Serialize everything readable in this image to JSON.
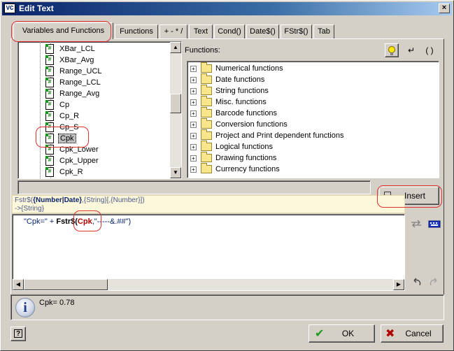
{
  "window": {
    "title": "Edit Text",
    "app_icon": "VC",
    "close": "×"
  },
  "tabs": [
    {
      "label": "Variables and Functions"
    },
    {
      "label": "Functions"
    },
    {
      "label": "+ - * /"
    },
    {
      "label": "Text"
    },
    {
      "label": "Cond()"
    },
    {
      "label": "Date$()"
    },
    {
      "label": "FStr$()"
    },
    {
      "label": "Tab"
    }
  ],
  "variables": [
    {
      "label": "XBar_LCL"
    },
    {
      "label": "XBar_Avg"
    },
    {
      "label": "Range_UCL"
    },
    {
      "label": "Range_LCL"
    },
    {
      "label": "Range_Avg"
    },
    {
      "label": "Cp"
    },
    {
      "label": "Cp_R"
    },
    {
      "label": "Cp_S"
    },
    {
      "label": "Cpk"
    },
    {
      "label": "Cpk_Lower"
    },
    {
      "label": "Cpk_Upper"
    },
    {
      "label": "Cpk_R"
    }
  ],
  "variable_icon_text": "#",
  "functions_panel": {
    "label": "Functions:",
    "items": [
      {
        "label": "Numerical functions"
      },
      {
        "label": "Date functions"
      },
      {
        "label": "String functions"
      },
      {
        "label": "Misc. functions"
      },
      {
        "label": "Barcode functions"
      },
      {
        "label": "Conversion functions"
      },
      {
        "label": "Project and Print dependent functions"
      },
      {
        "label": "Logical functions"
      },
      {
        "label": "Drawing functions"
      },
      {
        "label": "Currency functions"
      }
    ],
    "tool_return": "↵",
    "tool_paren": "( )",
    "tree_plus": "+"
  },
  "insert_button": {
    "label": "Insert"
  },
  "syntax_hint": {
    "line1_a": "Fstr$(",
    "line1_b": "{Number|Date}",
    "line1_c": ",{String}[,{Number}])",
    "line2": "->{String}"
  },
  "expression": {
    "p1": "\"Cpk=\" + ",
    "p2": "Fstr$(",
    "p3": "Cpk",
    "p4": ",\"-----&.##\")"
  },
  "result": {
    "text": "Cpk= 0.78",
    "icon_text": "i"
  },
  "buttons": {
    "help": "?",
    "ok": "OK",
    "cancel": "Cancel",
    "ok_check": "✔",
    "cancel_x": "✖"
  },
  "colors": {
    "title_bar": "#0a246a",
    "ok_check": "#1e9a1e",
    "cancel_x": "#b00000",
    "highlight": "#e03030",
    "syntax_background": "#fdf7dc"
  }
}
